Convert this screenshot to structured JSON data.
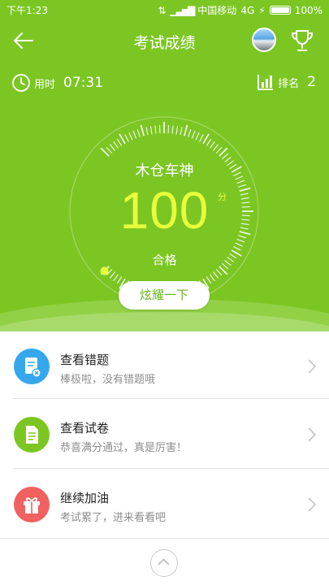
{
  "status_bar": {
    "time": "下午1:23",
    "carrier": "中国移动",
    "network": "4G",
    "battery": "100%"
  },
  "header": {
    "title": "考试成绩",
    "back_icon": "arrow-left-icon",
    "trophy_icon": "trophy-icon"
  },
  "stats": {
    "time_label": "用时",
    "time_value": "07:31",
    "rank_label": "排名",
    "rank_value": "2"
  },
  "result": {
    "name": "木仓车神",
    "score": "100",
    "unit": "分",
    "verdict": "合格",
    "share_label": "炫耀一下"
  },
  "list": [
    {
      "title": "查看错题",
      "subtitle": "棒极啦，没有错题哦",
      "icon": "wrong-questions-icon",
      "color": "#35a7ec"
    },
    {
      "title": "查看试卷",
      "subtitle": "恭喜满分通过，真是厉害！",
      "icon": "document-icon",
      "color": "#7cc623"
    },
    {
      "title": "继续加油",
      "subtitle": "考试累了，进来看看吧",
      "icon": "gift-icon",
      "color": "#f0615f"
    }
  ],
  "colors": {
    "brand_green": "#7cc623",
    "score_yellow": "#e8ff3c"
  }
}
